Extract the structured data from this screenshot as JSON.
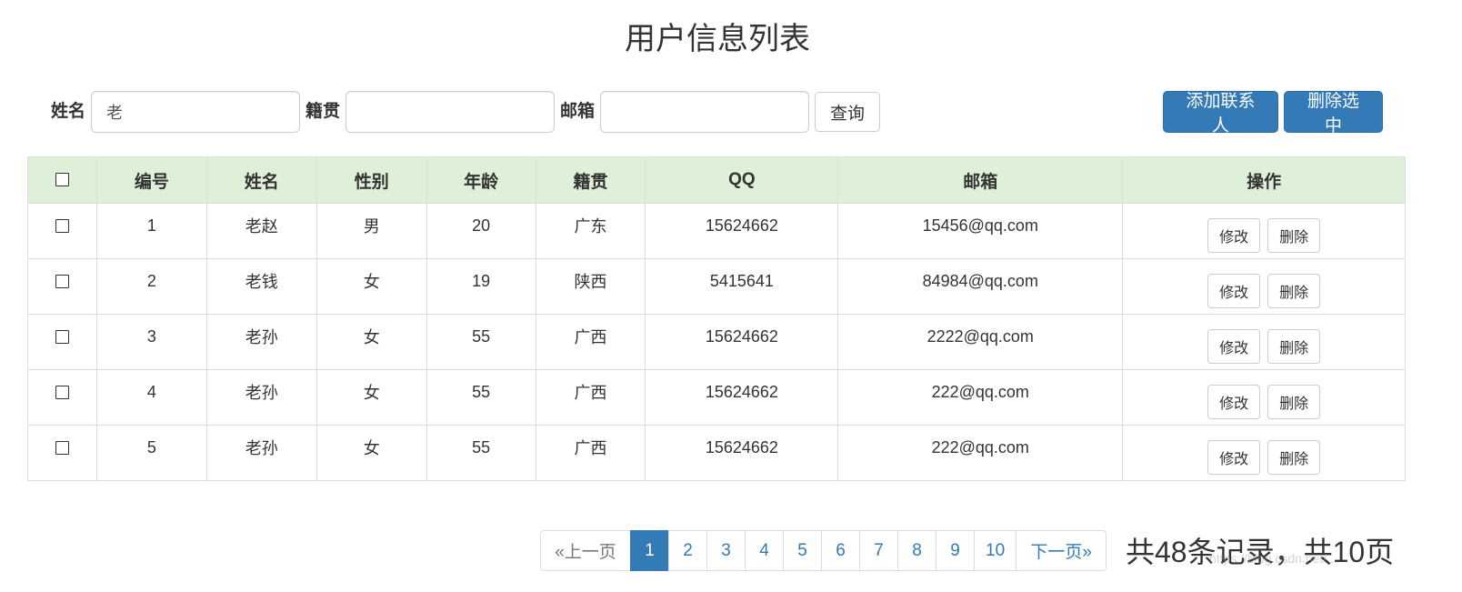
{
  "title": "用户信息列表",
  "search": {
    "name_label": "姓名",
    "name_value": "老",
    "origin_label": "籍贯",
    "origin_value": "",
    "email_label": "邮箱",
    "email_value": "",
    "query_button": "查询"
  },
  "actions": {
    "add_contact": "添加联系人",
    "delete_selected": "删除选中"
  },
  "table": {
    "headers": {
      "id": "编号",
      "name": "姓名",
      "gender": "性别",
      "age": "年龄",
      "origin": "籍贯",
      "qq": "QQ",
      "email": "邮箱",
      "ops": "操作"
    },
    "edit_label": "修改",
    "delete_label": "删除",
    "rows": [
      {
        "id": "1",
        "name": "老赵",
        "gender": "男",
        "age": "20",
        "origin": "广东",
        "qq": "15624662",
        "email": "15456@qq.com"
      },
      {
        "id": "2",
        "name": "老钱",
        "gender": "女",
        "age": "19",
        "origin": "陕西",
        "qq": "5415641",
        "email": "84984@qq.com"
      },
      {
        "id": "3",
        "name": "老孙",
        "gender": "女",
        "age": "55",
        "origin": "广西",
        "qq": "15624662",
        "email": "2222@qq.com"
      },
      {
        "id": "4",
        "name": "老孙",
        "gender": "女",
        "age": "55",
        "origin": "广西",
        "qq": "15624662",
        "email": "222@qq.com"
      },
      {
        "id": "5",
        "name": "老孙",
        "gender": "女",
        "age": "55",
        "origin": "广西",
        "qq": "15624662",
        "email": "222@qq.com"
      }
    ]
  },
  "pagination": {
    "prev": "«上一页",
    "pages": [
      "1",
      "2",
      "3",
      "4",
      "5",
      "6",
      "7",
      "8",
      "9",
      "10"
    ],
    "active_page": "1",
    "next": "下一页»",
    "summary": "共48条记录，共10页"
  },
  "watermark": "https://blog.csdn.net/..."
}
